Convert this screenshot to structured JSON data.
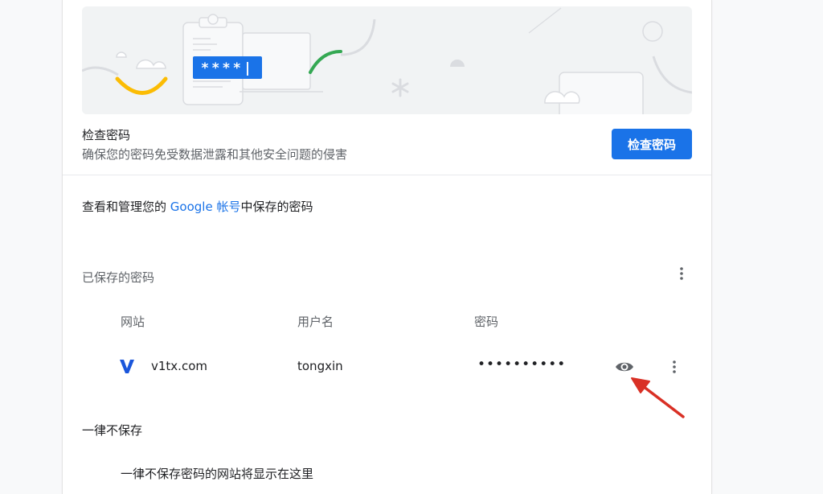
{
  "banner": {
    "masked_password": "****|",
    "colors": {
      "background": "#f1f3f4",
      "accent_blue": "#1a73e8",
      "accent_green": "#34a853",
      "accent_yellow": "#fbbc04",
      "outline": "#dadce0"
    }
  },
  "password_check": {
    "title": "检查密码",
    "description": "确保您的密码免受数据泄露和其他安全问题的侵害",
    "button_label": "检查密码"
  },
  "manage": {
    "prefix": "查看和管理您的 ",
    "link_text": "Google 帐号",
    "suffix": "中保存的密码"
  },
  "saved_passwords": {
    "heading": "已保存的密码",
    "menu_icon": "more-vert-icon",
    "columns": {
      "site": "网站",
      "username": "用户名",
      "password": "密码"
    },
    "rows": [
      {
        "favicon_letter": "V",
        "site": "v1tx.com",
        "username": "tongxin",
        "password_masked": "••••••••••",
        "show_icon": "eye-icon",
        "menu_icon": "more-vert-icon"
      }
    ]
  },
  "never_saved": {
    "heading": "一律不保存",
    "empty_message": "一律不保存密码的网站将显示在这里"
  },
  "annotation": {
    "color": "#d93025"
  }
}
